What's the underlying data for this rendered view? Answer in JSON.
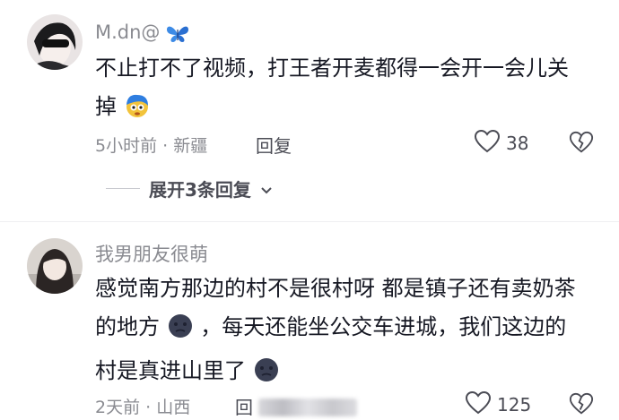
{
  "comments": [
    {
      "username": "M.dn@",
      "text_part1": "不止打不了视频，打王者开麦都得一会开一会儿关掉",
      "time": "5小时前",
      "location": "新疆",
      "reply_label": "回复",
      "likes": "38",
      "expand_label": "展开3条回复"
    },
    {
      "username": "我男朋友很萌",
      "text_part1": "感觉南方那边的村不是很村呀 都是镇子还有卖奶茶的地方",
      "text_part2": "，每天还能坐公交车进城，我们这边的村是真进山里了",
      "time": "2天前",
      "location": "山西",
      "reply_label": "回",
      "likes": "125"
    }
  ],
  "meta_sep": "·",
  "colors": {
    "text": "#161823",
    "meta": "#8a8b91",
    "action": "#4b4c55"
  }
}
